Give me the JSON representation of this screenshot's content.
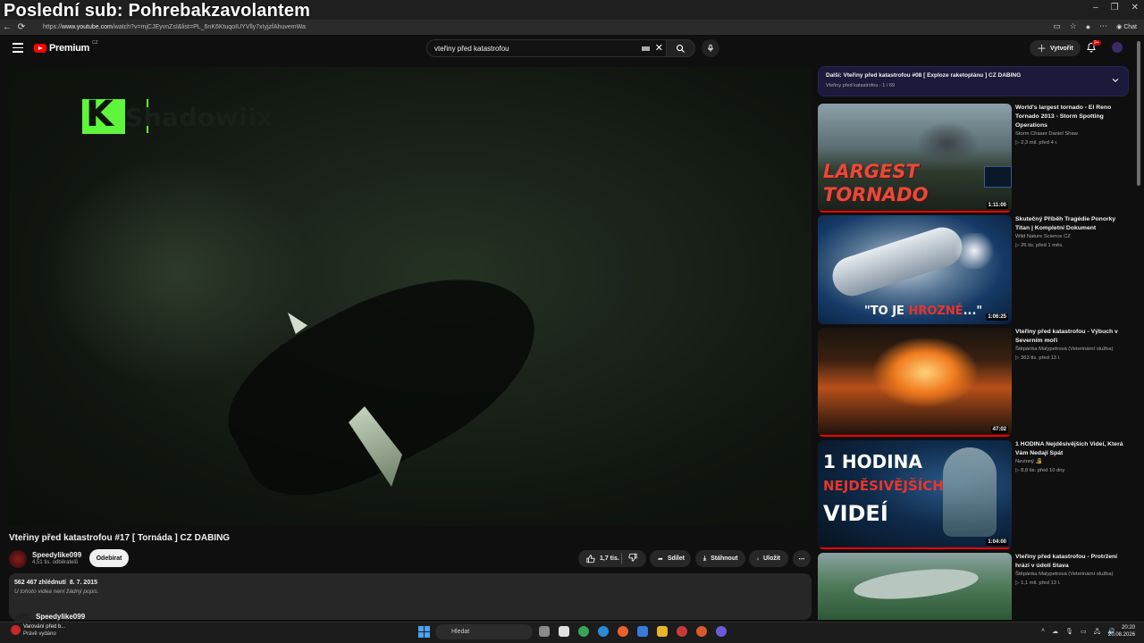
{
  "overlay": {
    "title": "Poslední sub: Pohrebakzavolantem"
  },
  "browser": {
    "url_prefix": "https://",
    "url_domain": "www.youtube.com",
    "url_rest": "/watch?v=mjCJEyvnZsI&list=PL_6nK6KtuqoIUYVlly7xIyjzfAhuvemWa",
    "chat_label": "Chat"
  },
  "youtube": {
    "logo_text": "Premium",
    "logo_country": "CZ",
    "search": {
      "value": "vteřiny před katastrofou"
    },
    "create_label": "Vytvořit",
    "notification_badge": "9+"
  },
  "video": {
    "watermark_text": "Shadowiix",
    "watermark_letter": "K",
    "title": "Vteřiny před katastrofou #17 [ Tornáda ] CZ DABING",
    "channel": {
      "name": "Speedylike099",
      "subscribers": "4,51 tis. odběratelů"
    },
    "subscribe_label": "Odebírat",
    "likes": "1,7 tis.",
    "share_label": "Sdílet",
    "download_label": "Stáhnout",
    "save_label": "Uložit",
    "stats": "562 467 zhlédnutí  8. 7. 2015",
    "description": "U tohoto videa není žádný popis.",
    "comment_author": "Speedylike099"
  },
  "playlist": {
    "next_label": "Další:",
    "next_title": "Vteřiny před katastrofou #08 [ Exploze raketoplánu ] CZ DABING",
    "sub": "Vteřiny před katastrofou - 1 / 69"
  },
  "recommendations": [
    {
      "title": "World's largest tornado - El Reno Tornado 2013 - Storm Spotting Operations",
      "channel": "Storm Chaser Daniel Shaw",
      "meta": "▷ 2,3 mil.   před 4 r.",
      "duration": "1:11:00",
      "thumb_text_1": "LARGEST",
      "thumb_text_2": "TORNADO",
      "progress": 1.0
    },
    {
      "title": "Skutečný Příběh Tragédie Ponorky Titan | Kompletní Dokument",
      "channel": "Wild Nature Science CZ",
      "meta": "▷ 26 tis.   před 1 měs.",
      "duration": "1:06:25",
      "thumb_text_1": "\"TO JE ",
      "thumb_text_2": "HROZNÉ",
      "thumb_text_3": "...\"",
      "progress": 0
    },
    {
      "title": "Vteřiny před katastrofou - Výbuch v Severním moři",
      "channel": "Štěpánka Malypetrová (Veterinární služba)",
      "meta": "▷ 363 tis.   před 13 l.",
      "duration": "47:02",
      "progress": 1.0
    },
    {
      "title": "1 HODINA Nejděsivějších Videí, Která Vám Nedají Spát",
      "channel": "Nevinný 🔏",
      "meta": "▷ 8,8 tis.   před 10 dny",
      "duration": "1:04:00",
      "thumb_text_1": "1 HODINA",
      "thumb_text_2": "NEJDĚSIVĚJŠÍCH",
      "thumb_text_3": "VIDEÍ",
      "progress": 1.0
    },
    {
      "title": "Vteřiny před katastrofou - Protržení hrází v údolí Stava",
      "channel": "Štěpánka Malypetrová (Veterinární služba)",
      "meta": "▷ 1,1 mil.   před 13 l.",
      "duration": "",
      "progress": 0
    }
  ],
  "taskbar": {
    "notif_title": "Varování před b...",
    "notif_sub": "Právě vydáno",
    "search_label": "Hledat",
    "time": "20:20",
    "date": "20.08.2026"
  },
  "colors": {
    "youtube_red": "#ff0000",
    "playlist_bg": "#1b1a3a",
    "watermark_green": "#5ef53a"
  }
}
